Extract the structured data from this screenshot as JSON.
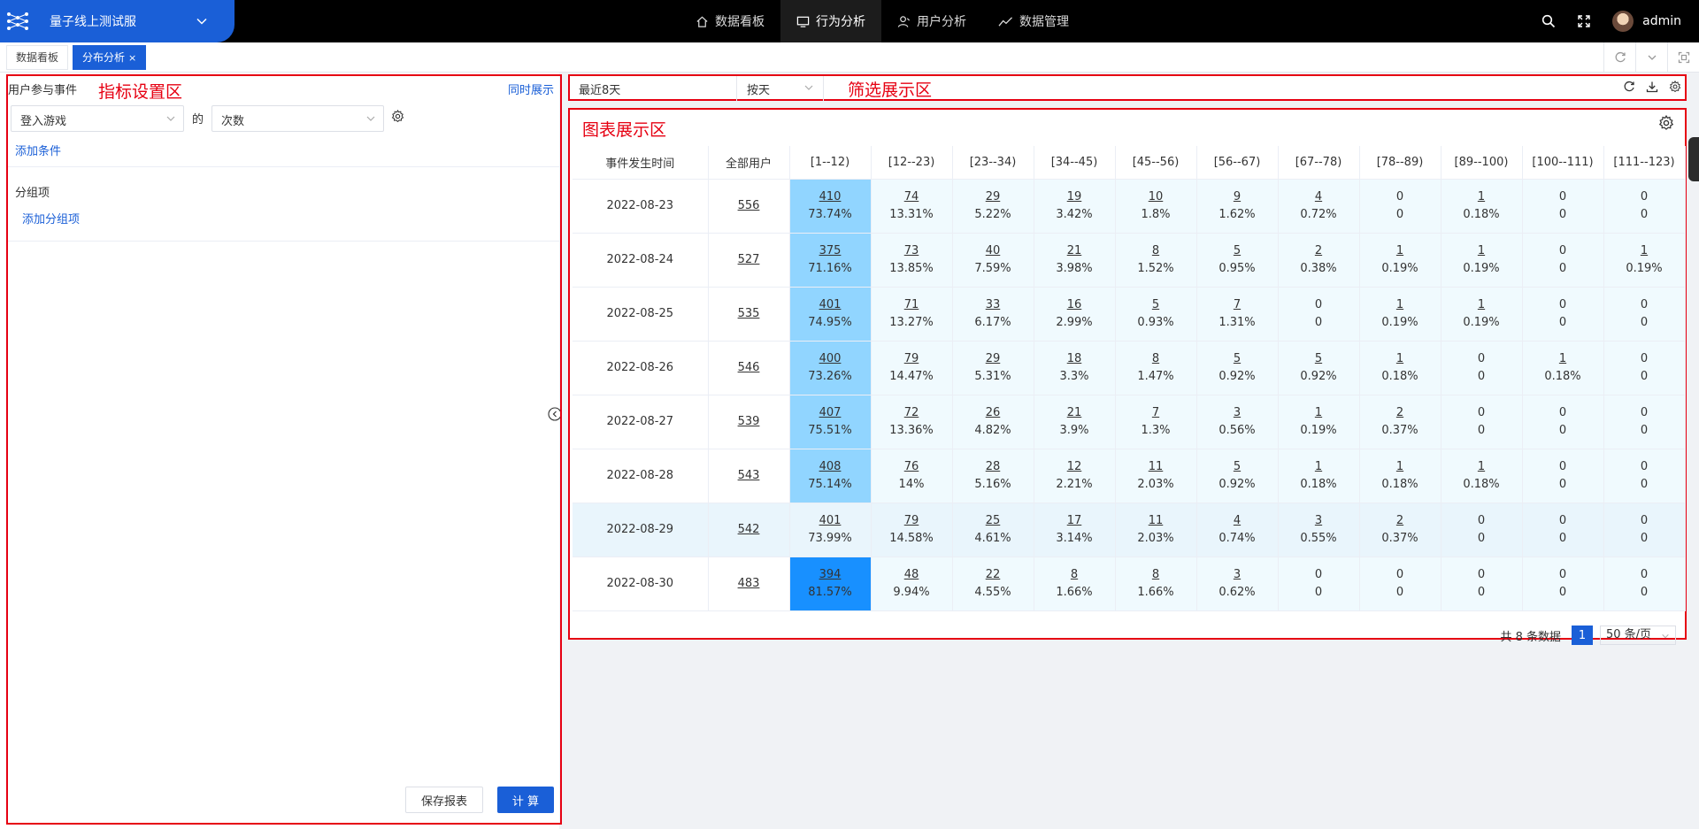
{
  "app": {
    "brand_name": "量子线上测试服"
  },
  "nav": [
    {
      "label": "数据看板",
      "icon": "home-icon"
    },
    {
      "label": "行为分析",
      "icon": "monitor-icon",
      "active": true
    },
    {
      "label": "用户分析",
      "icon": "user-icon"
    },
    {
      "label": "数据管理",
      "icon": "trend-icon"
    }
  ],
  "user": {
    "name": "admin"
  },
  "tabs": [
    {
      "label": "数据看板"
    },
    {
      "label": "分布分析",
      "active": true,
      "close": "×"
    }
  ],
  "left": {
    "annotation": "指标设置区",
    "title": "用户参与事件",
    "link": "同时展示",
    "event_select": "登入游戏",
    "de_text": "的",
    "metric_select": "次数",
    "add_condition": "添加条件",
    "group_title": "分组项",
    "add_group": "添加分组项",
    "save_button": "保存报表",
    "compute_button": "计 算"
  },
  "filter": {
    "annotation": "筛选展示区",
    "date_range": "最近8天",
    "granularity": "按天"
  },
  "chart": {
    "annotation": "图表展示区",
    "headers": [
      "事件发生时间",
      "全部用户",
      "[1--12)",
      "[12--23)",
      "[23--34)",
      "[34--45)",
      "[45--56)",
      "[56--67)",
      "[67--78)",
      "[78--89)",
      "[89--100)",
      "[100--111)",
      "[111--123)"
    ],
    "rows": [
      {
        "date": "2022-08-23",
        "total": "556",
        "cells": [
          [
            "410",
            "73.74%"
          ],
          [
            "74",
            "13.31%"
          ],
          [
            "29",
            "5.22%"
          ],
          [
            "19",
            "3.42%"
          ],
          [
            "10",
            "1.8%"
          ],
          [
            "9",
            "1.62%"
          ],
          [
            "4",
            "0.72%"
          ],
          [
            "0",
            "0"
          ],
          [
            "1",
            "0.18%"
          ],
          [
            "0",
            "0"
          ],
          [
            "0",
            "0"
          ]
        ]
      },
      {
        "date": "2022-08-24",
        "total": "527",
        "cells": [
          [
            "375",
            "71.16%"
          ],
          [
            "73",
            "13.85%"
          ],
          [
            "40",
            "7.59%"
          ],
          [
            "21",
            "3.98%"
          ],
          [
            "8",
            "1.52%"
          ],
          [
            "5",
            "0.95%"
          ],
          [
            "2",
            "0.38%"
          ],
          [
            "1",
            "0.19%"
          ],
          [
            "1",
            "0.19%"
          ],
          [
            "0",
            "0"
          ],
          [
            "1",
            "0.19%"
          ]
        ]
      },
      {
        "date": "2022-08-25",
        "total": "535",
        "cells": [
          [
            "401",
            "74.95%"
          ],
          [
            "71",
            "13.27%"
          ],
          [
            "33",
            "6.17%"
          ],
          [
            "16",
            "2.99%"
          ],
          [
            "5",
            "0.93%"
          ],
          [
            "7",
            "1.31%"
          ],
          [
            "0",
            "0"
          ],
          [
            "1",
            "0.19%"
          ],
          [
            "1",
            "0.19%"
          ],
          [
            "0",
            "0"
          ],
          [
            "0",
            "0"
          ]
        ]
      },
      {
        "date": "2022-08-26",
        "total": "546",
        "cells": [
          [
            "400",
            "73.26%"
          ],
          [
            "79",
            "14.47%"
          ],
          [
            "29",
            "5.31%"
          ],
          [
            "18",
            "3.3%"
          ],
          [
            "8",
            "1.47%"
          ],
          [
            "5",
            "0.92%"
          ],
          [
            "5",
            "0.92%"
          ],
          [
            "1",
            "0.18%"
          ],
          [
            "0",
            "0"
          ],
          [
            "1",
            "0.18%"
          ],
          [
            "0",
            "0"
          ]
        ]
      },
      {
        "date": "2022-08-27",
        "total": "539",
        "cells": [
          [
            "407",
            "75.51%"
          ],
          [
            "72",
            "13.36%"
          ],
          [
            "26",
            "4.82%"
          ],
          [
            "21",
            "3.9%"
          ],
          [
            "7",
            "1.3%"
          ],
          [
            "3",
            "0.56%"
          ],
          [
            "1",
            "0.19%"
          ],
          [
            "2",
            "0.37%"
          ],
          [
            "0",
            "0"
          ],
          [
            "0",
            "0"
          ],
          [
            "0",
            "0"
          ]
        ]
      },
      {
        "date": "2022-08-28",
        "total": "543",
        "cells": [
          [
            "408",
            "75.14%"
          ],
          [
            "76",
            "14%"
          ],
          [
            "28",
            "5.16%"
          ],
          [
            "12",
            "2.21%"
          ],
          [
            "11",
            "2.03%"
          ],
          [
            "5",
            "0.92%"
          ],
          [
            "1",
            "0.18%"
          ],
          [
            "1",
            "0.18%"
          ],
          [
            "1",
            "0.18%"
          ],
          [
            "0",
            "0"
          ],
          [
            "0",
            "0"
          ]
        ]
      },
      {
        "date": "2022-08-29",
        "total": "542",
        "cells": [
          [
            "401",
            "73.99%"
          ],
          [
            "79",
            "14.58%"
          ],
          [
            "25",
            "4.61%"
          ],
          [
            "17",
            "3.14%"
          ],
          [
            "11",
            "2.03%"
          ],
          [
            "4",
            "0.74%"
          ],
          [
            "3",
            "0.55%"
          ],
          [
            "2",
            "0.37%"
          ],
          [
            "0",
            "0"
          ],
          [
            "0",
            "0"
          ],
          [
            "0",
            "0"
          ]
        ],
        "highlight": true
      },
      {
        "date": "2022-08-30",
        "total": "483",
        "cells": [
          [
            "394",
            "81.57%"
          ],
          [
            "48",
            "9.94%"
          ],
          [
            "22",
            "4.55%"
          ],
          [
            "8",
            "1.66%"
          ],
          [
            "8",
            "1.66%"
          ],
          [
            "3",
            "0.62%"
          ],
          [
            "0",
            "0"
          ],
          [
            "0",
            "0"
          ],
          [
            "0",
            "0"
          ],
          [
            "0",
            "0"
          ],
          [
            "0",
            "0"
          ]
        ]
      }
    ],
    "pagination": {
      "total_text": "共 8 条数据",
      "current_page": "1",
      "page_size": "50 条/页"
    }
  },
  "colors": {
    "accent": "#1a5fd7",
    "annotation": "#e60012",
    "cell_light": "#91d5ff",
    "cell_dark": "#1890ff"
  }
}
